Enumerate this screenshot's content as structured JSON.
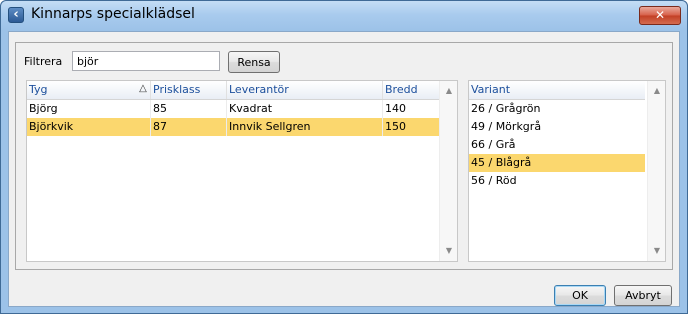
{
  "window": {
    "title": "Kinnarps specialklädsel",
    "close_glyph": "✕",
    "app_icon_glyph": "‹",
    "app_icon": "back-arrow-icon"
  },
  "filter": {
    "label": "Filtrera",
    "value": "björ",
    "clear_label": "Rensa"
  },
  "fabric_table": {
    "columns": [
      "Tyg",
      "Prisklass",
      "Leverantör",
      "Bredd"
    ],
    "sort_indicator": "△",
    "rows": [
      {
        "tyg": "Björg",
        "prisklass": "85",
        "leverantor": "Kvadrat",
        "bredd": "140"
      },
      {
        "tyg": "Björkvik",
        "prisklass": "87",
        "leverantor": "Innvik Sellgren",
        "bredd": "150"
      }
    ],
    "selected_row": 1
  },
  "variant_table": {
    "columns": [
      "Variant"
    ],
    "rows": [
      "26 / Grågrön",
      "49 / Mörkgrå",
      "66 / Grå",
      "45 / Blågrå",
      "56 / Röd"
    ],
    "selected_row": 3
  },
  "scroll": {
    "up_glyph": "▲",
    "down_glyph": "▼"
  },
  "footer": {
    "ok_label": "OK",
    "cancel_label": "Avbryt"
  },
  "colors": {
    "selection": "#fbd76e",
    "header_text": "#1c4f9c",
    "window_frame": "#9cc2e8",
    "close_button": "#c23f25"
  }
}
